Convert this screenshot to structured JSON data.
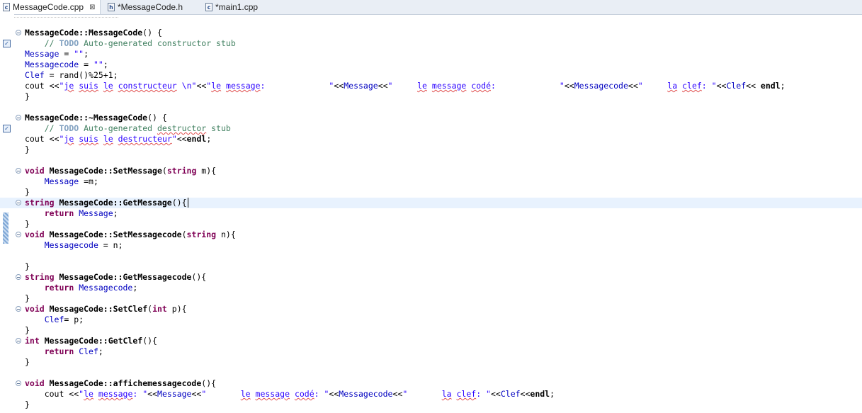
{
  "tabs": [
    {
      "label": "MessageCode.cpp",
      "icon": "cpp-file-icon",
      "glyph": "c",
      "active": true
    },
    {
      "label": "*MessageCode.h",
      "icon": "header-file-icon",
      "glyph": "h",
      "active": false
    },
    {
      "label": "*main1.cpp",
      "icon": "cpp-file-icon",
      "glyph": "c",
      "active": false
    }
  ],
  "close_glyph": "⊠",
  "code": [
    "MessageCode::MessageCode() {",
    "    // TODO Auto-generated constructor stub",
    "Message = \"\";",
    "Messagecode = \"\";",
    "Clef = rand()%25+1;",
    "cout <<\"je suis le constructeur \\n\"<<\"le message:             \"<<Message<<\"     le message codé:             \"<<Messagecode<<\"     la clef: \"<<Clef<< endl;",
    "}",
    "",
    "MessageCode::~MessageCode() {",
    "    // TODO Auto-generated destructor stub",
    "cout <<\"je suis le destructeur\"<<endl;",
    "}",
    "",
    "void MessageCode::SetMessage(string m){",
    "    Message =m;",
    "}",
    "string MessageCode::GetMessage(){",
    "    return Message;",
    "}",
    "void MessageCode::SetMessagecode(string n){",
    "    Messagecode = n;",
    "",
    "}",
    "string MessageCode::GetMessagecode(){",
    "    return Messagecode;",
    "}",
    "void MessageCode::SetClef(int p){",
    "    Clef= p;",
    "}",
    "int MessageCode::GetClef(){",
    "    return Clef;",
    "}",
    "",
    "void MessageCode::affichemessagecode(){",
    "    cout <<\"le message: \"<<Message<<\"       le message codé: \"<<Messagecode<<\"       la clef: \"<<Clef<<endl;",
    "}"
  ],
  "colors": {
    "keyword": "#7f0055",
    "field": "#0000c0",
    "string": "#2a00ff",
    "comment": "#3f7f5f",
    "current_line": "#e8f2fe"
  }
}
